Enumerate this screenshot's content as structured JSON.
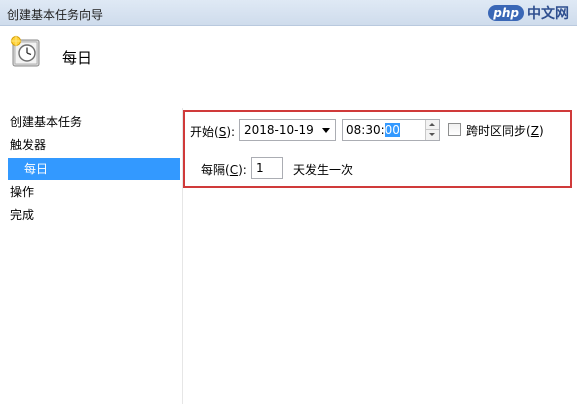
{
  "window": {
    "title": "创建基本任务向导"
  },
  "watermark": {
    "logo": "php",
    "text": "中文网"
  },
  "header": {
    "page_title": "每日",
    "icon": "scheduler-clock-icon"
  },
  "nav": {
    "items": [
      {
        "label": "创建基本任务"
      },
      {
        "label": "触发器"
      },
      {
        "label": "每日",
        "selected": true
      },
      {
        "label": "操作"
      },
      {
        "label": "完成"
      }
    ]
  },
  "trigger": {
    "start_label": "开始",
    "start_key": "S",
    "date_value": "2018-10-19",
    "time_prefix": "08:30:",
    "time_selected": "00",
    "sync_label": "跨时区同步",
    "sync_key": "Z",
    "sync_checked": false,
    "recur_label": "每隔",
    "recur_key": "C",
    "recur_value": "1",
    "recur_suffix": "天发生一次"
  },
  "colors": {
    "selection": "#3399ff",
    "highlight_border": "#d03a3a",
    "titlebar": "#dfe9f5"
  }
}
